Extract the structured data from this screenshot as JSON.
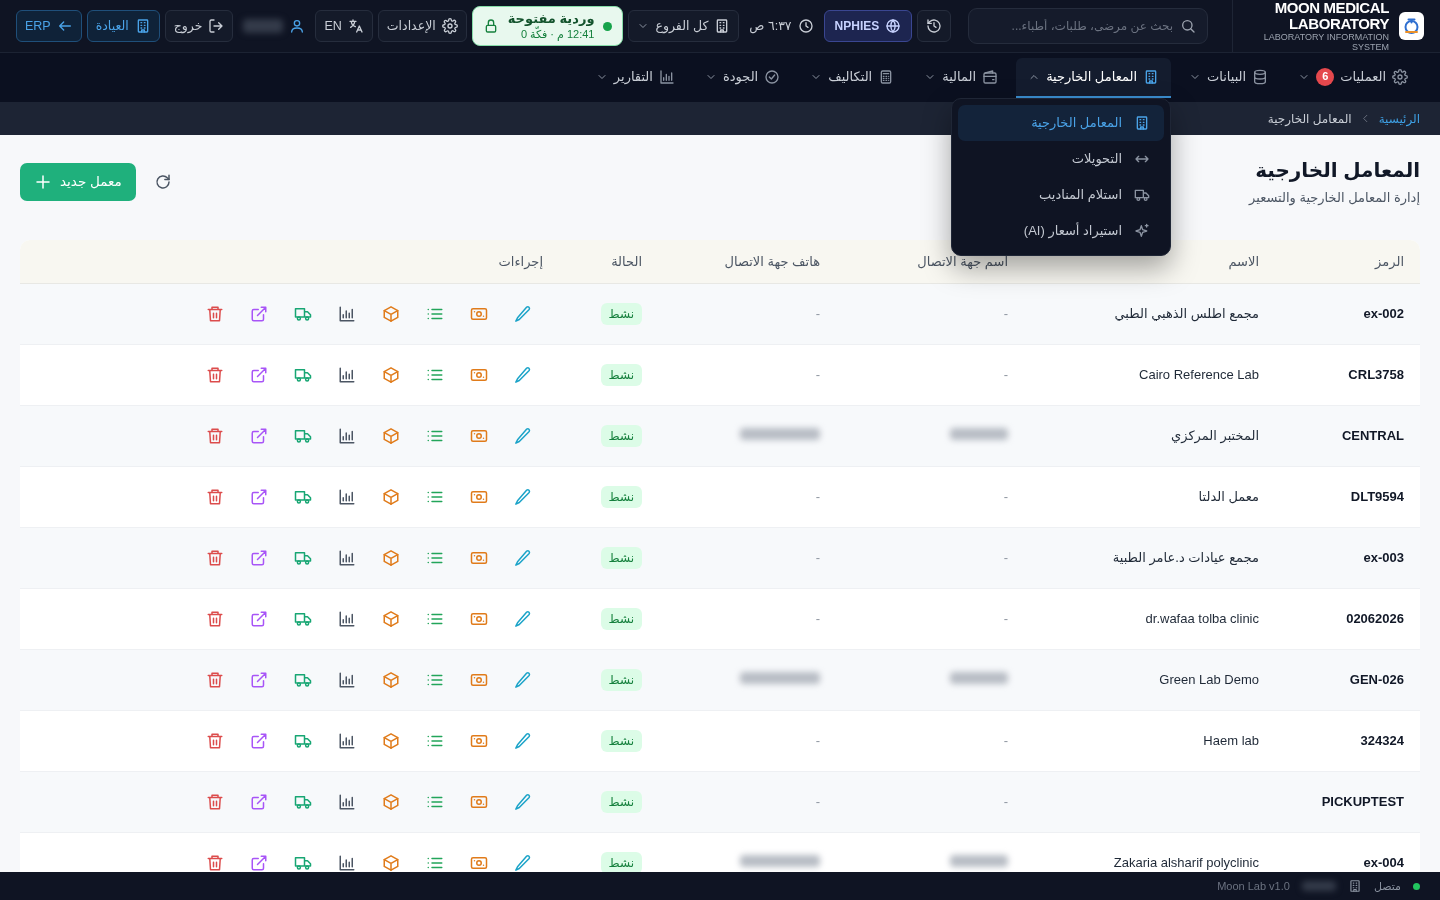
{
  "header": {
    "logo_title": "MOON MEDICAL LABORATORY",
    "logo_subtitle": "LABORATORY INFORMATION SYSTEM",
    "search": {
      "placeholder": "بحث عن مرضى، طلبات، أطباء..."
    },
    "nphies": "NPHIES",
    "time": "٦:٣٧ ص",
    "branch": "كل الفروع",
    "shift": {
      "title": "وردية مفتوحة",
      "detail": "12:41 م · فكّة 0",
      "open": true
    },
    "settings": "الإعدادات",
    "language": "EN",
    "user": {
      "redacted": true
    },
    "logout": "خروج",
    "clinic": "العيادة",
    "erp": "ERP"
  },
  "nav": [
    {
      "label": "العمليات",
      "badge": "6",
      "selected": false,
      "expanded": false
    },
    {
      "label": "البيانات",
      "selected": false,
      "expanded": false
    },
    {
      "label": "المعامل الخارجية",
      "selected": true,
      "expanded": true,
      "menu": [
        {
          "label": "المعامل الخارجية",
          "selected": true
        },
        {
          "label": "التحويلات",
          "selected": false
        },
        {
          "label": "استلام المناديب",
          "selected": false
        },
        {
          "label": "استيراد أسعار (AI)",
          "selected": false
        }
      ]
    },
    {
      "label": "المالية",
      "selected": false,
      "expanded": false
    },
    {
      "label": "التكاليف",
      "selected": false,
      "expanded": false
    },
    {
      "label": "الجودة",
      "selected": false,
      "expanded": false
    },
    {
      "label": "التقارير",
      "selected": false,
      "expanded": false
    }
  ],
  "breadcrumb": [
    {
      "label": "الرئيسية",
      "kind": "link"
    },
    {
      "label": "المعامل الخارجية",
      "kind": "current"
    }
  ],
  "page": {
    "title": "المعامل الخارجية",
    "subtitle": "إدارة المعامل الخارجية والتسعير",
    "new_button": "معمل جديد"
  },
  "table": {
    "columns": [
      "الرمز",
      "الاسم",
      "اسم جهة الاتصال",
      "هاتف جهة الاتصال",
      "الحالة",
      "إجراءات"
    ],
    "rows": [
      {
        "code": "ex-002",
        "name": "مجمع اطلس الذهبي الطبي",
        "contact_name": "-",
        "contact_phone": "-",
        "redacted": false,
        "status": "نشط",
        "active": true
      },
      {
        "code": "CRL3758",
        "name": "Cairo Reference Lab",
        "contact_name": "-",
        "contact_phone": "-",
        "redacted": false,
        "status": "نشط",
        "active": true
      },
      {
        "code": "CENTRAL",
        "name": "المختبر المركزي",
        "redacted": true,
        "status": "نشط",
        "active": true
      },
      {
        "code": "DLT9594",
        "name": "معمل الدلتا",
        "contact_name": "-",
        "contact_phone": "-",
        "redacted": false,
        "status": "نشط",
        "active": true
      },
      {
        "code": "ex-003",
        "name": "مجمع عيادات د.عامر الطبية",
        "contact_name": "-",
        "contact_phone": "-",
        "redacted": false,
        "status": "نشط",
        "active": true
      },
      {
        "code": "02062026",
        "name": "dr.wafaa tolba clinic",
        "contact_name": "-",
        "contact_phone": "-",
        "redacted": false,
        "status": "نشط",
        "active": true
      },
      {
        "code": "GEN-026",
        "name": "Green Lab Demo",
        "redacted": true,
        "status": "نشط",
        "active": true
      },
      {
        "code": "324324",
        "name": "Haem lab",
        "contact_name": "-",
        "contact_phone": "-",
        "redacted": false,
        "status": "نشط",
        "active": true
      },
      {
        "code": "PICKUPTEST",
        "contact_name": "-",
        "contact_phone": "-",
        "redacted": false,
        "status": "نشط",
        "active": true
      },
      {
        "code": "ex-004",
        "name": "Zakaria alsharif polyclinic",
        "redacted": true,
        "status": "نشط",
        "active": true
      }
    ]
  },
  "status_bar": {
    "connection": "متصل",
    "connected": true,
    "branch_redacted": true,
    "version": "Moon Lab v1.0"
  }
}
